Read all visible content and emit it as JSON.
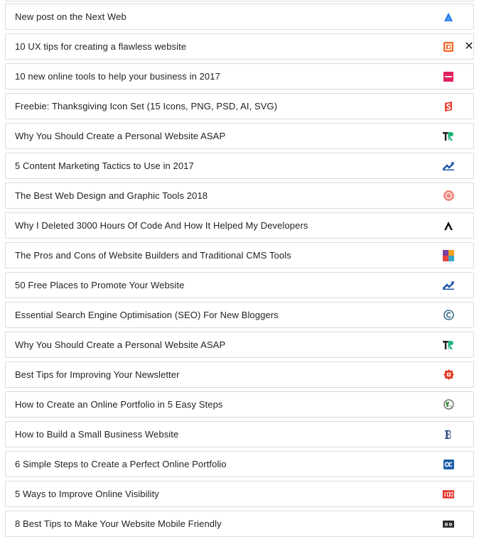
{
  "feed": {
    "items": [
      {
        "title": "New post on the Next Web",
        "icon": "tnw-icon"
      },
      {
        "title": "10 UX tips for creating a flawless website",
        "icon": "cb-icon"
      },
      {
        "title": "10 new online tools to help your business in 2017",
        "icon": "inc-icon"
      },
      {
        "title": "Freebie: Thanksgiving Icon Set (15 Icons, PNG, PSD, AI, SVG)",
        "icon": "smashing-icon"
      },
      {
        "title": "Why You Should Create a Personal Website ASAP",
        "icon": "tr-icon"
      },
      {
        "title": "5 Content Marketing Tactics to Use in 2017",
        "icon": "trend-icon"
      },
      {
        "title": "The Best Web Design and Graphic Tools 2018",
        "icon": "fsg-icon"
      },
      {
        "title": "Why I Deleted 3000 Hours Of Code And How It Helped My Developers",
        "icon": "a-icon"
      },
      {
        "title": "The Pros and Cons of Website Builders and Traditional CMS Tools",
        "icon": "squares-icon"
      },
      {
        "title": "50 Free Places to Promote Your Website",
        "icon": "trend-icon"
      },
      {
        "title": "Essential Search Engine Optimisation (SEO) For New Bloggers",
        "icon": "c-circle-icon"
      },
      {
        "title": "Why You Should Create a Personal Website ASAP",
        "icon": "tr-icon"
      },
      {
        "title": "Best Tips for Improving Your Newsletter",
        "icon": "red-badge-icon"
      },
      {
        "title": "How to Create an Online Portfolio in 5 Easy Steps",
        "icon": "globe-icon"
      },
      {
        "title": "How to Build a Small Business Website",
        "icon": "b-icon"
      },
      {
        "title": "6 Simple Steps to Create a Perfect Online Portfolio",
        "icon": "oc-icon"
      },
      {
        "title": "5 Ways to Improve Online Visibility",
        "icon": "sbd-icon"
      },
      {
        "title": "8 Best Tips to Make Your Website Mobile Friendly",
        "icon": "owl-icon"
      }
    ]
  },
  "close_label": "✕"
}
